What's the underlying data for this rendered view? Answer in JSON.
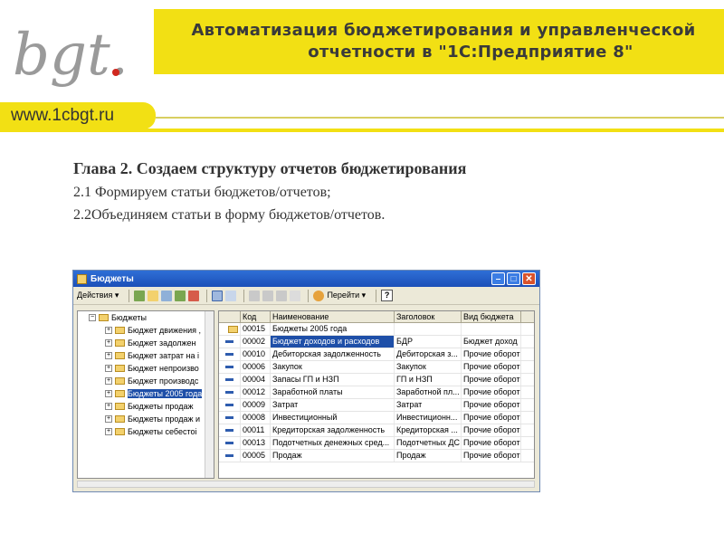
{
  "logo": {
    "text": "bgt."
  },
  "banner": {
    "line1": "Автоматизация бюджетирования и управленческой",
    "line2": "отчетности в \"1С:Предприятие 8\""
  },
  "site_url": "www.1cbgt.ru",
  "colors": {
    "accent_yellow": "#f2e014",
    "selection_blue": "#1e4fa8"
  },
  "content": {
    "chapter_title": "Глава 2. Создаем структуру отчетов бюджетирования",
    "point1": "2.1 Формируем статьи бюджетов/отчетов;",
    "point2": "2.2Объединяем статьи в форму бюджетов/отчетов."
  },
  "window": {
    "title": "Бюджеты",
    "toolbar": {
      "actions_label": "Действия ▾",
      "goto_label": "Перейти ▾",
      "help_label": "?"
    },
    "tree": {
      "root": "Бюджеты",
      "items": [
        "Бюджет движения ,",
        "Бюджет задолжен",
        "Бюджет затрат на і",
        "Бюджет непроизво",
        "Бюджет производс",
        "Бюджеты 2005 года",
        "Бюджеты продаж",
        "Бюджеты продаж и",
        "Бюджеты себестоі"
      ],
      "selected_index": 5
    },
    "grid": {
      "columns": [
        "Код",
        "Наименование",
        "Заголовок",
        "Вид бюджета"
      ],
      "rows": [
        {
          "code": "00015",
          "name": "Бюджеты 2005 года",
          "header": "",
          "kind": ""
        },
        {
          "code": "00002",
          "name": "Бюджет доходов и расходов",
          "header": "БДР",
          "kind": "Бюджет доход"
        },
        {
          "code": "00010",
          "name": "Дебиторская задолженность",
          "header": "Дебиторская з...",
          "kind": "Прочие оборот"
        },
        {
          "code": "00006",
          "name": "Закупок",
          "header": "Закупок",
          "kind": "Прочие оборот"
        },
        {
          "code": "00004",
          "name": "Запасы ГП и НЗП",
          "header": "ГП и НЗП",
          "kind": "Прочие оборот"
        },
        {
          "code": "00012",
          "name": "Заработной платы",
          "header": "Заработной пл...",
          "kind": "Прочие оборот"
        },
        {
          "code": "00009",
          "name": "Затрат",
          "header": "Затрат",
          "kind": "Прочие оборот"
        },
        {
          "code": "00008",
          "name": "Инвестиционный",
          "header": "Инвестиционн...",
          "kind": "Прочие оборот"
        },
        {
          "code": "00011",
          "name": "Кредиторская задолженность",
          "header": "Кредиторская ...",
          "kind": "Прочие оборот"
        },
        {
          "code": "00013",
          "name": "Подотчетных денежных сред...",
          "header": "Подотчетных ДС",
          "kind": "Прочие оборот"
        },
        {
          "code": "00005",
          "name": "Продаж",
          "header": "Продаж",
          "kind": "Прочие оборот"
        }
      ]
    }
  }
}
